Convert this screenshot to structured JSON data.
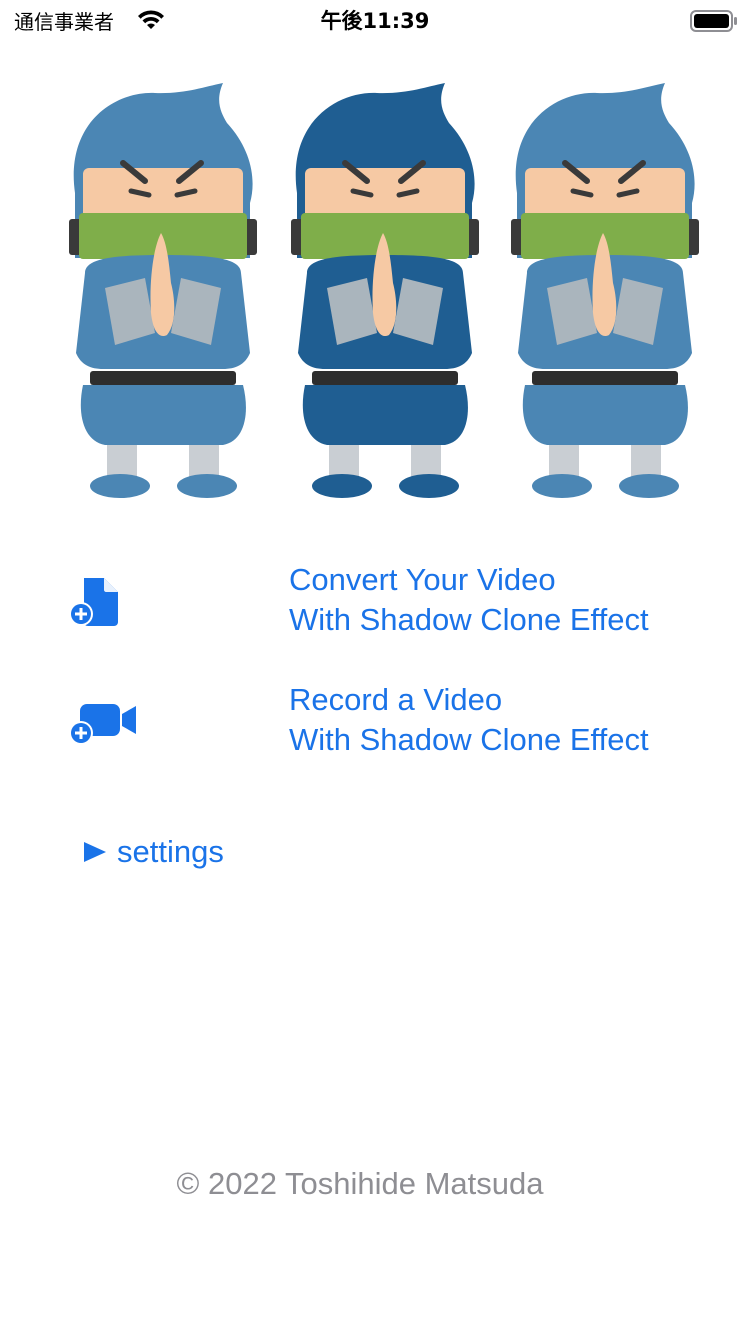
{
  "status_bar": {
    "carrier": "通信事業者",
    "time": "午後11:39"
  },
  "hero": {
    "image_icon": "three-ninja-clones-illustration",
    "ninja_colors": [
      "#4b86b4",
      "#1f5e92",
      "#4b86b4"
    ],
    "mask_color": "#7fae4a"
  },
  "menu": {
    "convert": {
      "icon": "document-add-icon",
      "line1": "Convert Your Video",
      "line2": "With Shadow Clone Effect"
    },
    "record": {
      "icon": "video-camera-add-icon",
      "line1": "Record a Video",
      "line2": "With Shadow Clone Effect"
    }
  },
  "settings": {
    "icon": "play-triangle-icon",
    "label": "settings"
  },
  "footer": {
    "copyright": "© 2022 Toshihide Matsuda"
  },
  "colors": {
    "accent": "#1a73e8",
    "secondary_text": "#8e8e93"
  }
}
